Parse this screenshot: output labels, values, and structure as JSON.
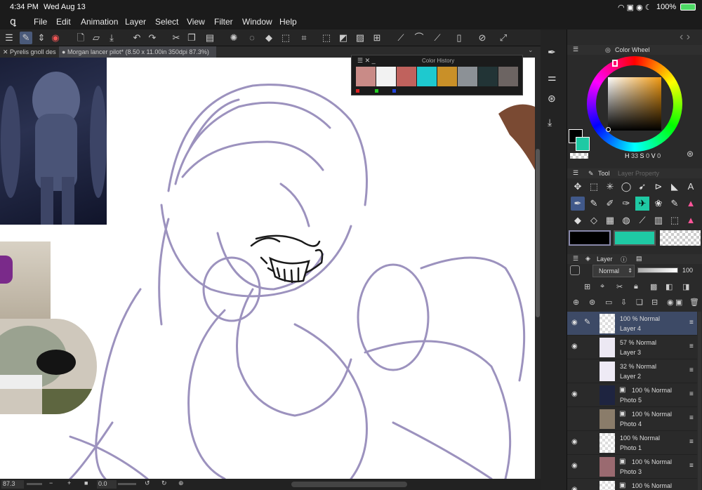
{
  "status": {
    "time": "4:34 PM",
    "date": "Wed Aug 13",
    "battery": "100%"
  },
  "menu": [
    "File",
    "Edit",
    "Animation",
    "Layer",
    "Select",
    "View",
    "Filter",
    "Window",
    "Help"
  ],
  "tabs": [
    {
      "label": "Pyrelis gnoll des"
    },
    {
      "label": "Morgan lancer pilot* (8.50 x 11.00in 350dpi 87.3%)"
    }
  ],
  "color_history": {
    "title": "Color History",
    "swatches": [
      "#c98b87",
      "#f2f2f2",
      "#c0625d",
      "#1ec9cf",
      "#c99028",
      "#8c9196",
      "#223436",
      "#6c6462"
    ]
  },
  "color_wheel": {
    "title": "Color Wheel",
    "h_label": "H",
    "h_value": "33",
    "s_label": "S",
    "s_value": "0",
    "v_label": "V",
    "v_value": "0",
    "main_color": "#000000",
    "sub_color": "#1fc9a4"
  },
  "tool_panel": {
    "tab_tool": "Tool",
    "tab_layer_property": "Layer Property"
  },
  "layer_panel": {
    "title": "Layer",
    "blend_mode": "Normal",
    "opacity": "100",
    "layers": [
      {
        "opacity_mode": "100 % Normal",
        "name": "Layer 4",
        "visible": true,
        "selected": true
      },
      {
        "opacity_mode": "57 % Normal",
        "name": "Layer 3",
        "visible": true,
        "selected": false
      },
      {
        "opacity_mode": "32 % Normal",
        "name": "Layer 2",
        "visible": false,
        "selected": false
      },
      {
        "opacity_mode": "100 % Normal",
        "name": "Photo 5",
        "visible": true,
        "selected": false
      },
      {
        "opacity_mode": "100 % Normal",
        "name": "Photo 4",
        "visible": false,
        "selected": false
      },
      {
        "opacity_mode": "100 % Normal",
        "name": "Photo 1",
        "visible": true,
        "selected": false
      },
      {
        "opacity_mode": "100 % Normal",
        "name": "Photo 3",
        "visible": true,
        "selected": false
      },
      {
        "opacity_mode": "100 % Normal",
        "name": "",
        "visible": true,
        "selected": false
      }
    ]
  },
  "bottom": {
    "zoom": "87.3",
    "rotation": "0.0"
  }
}
